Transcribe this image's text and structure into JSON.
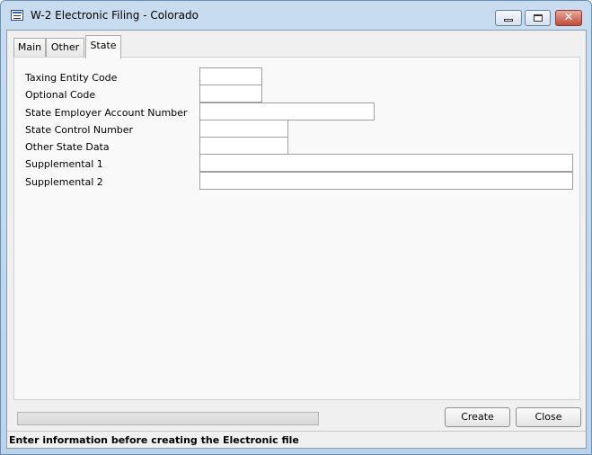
{
  "window": {
    "title": "W-2 Electronic Filing - Colorado"
  },
  "tabs": [
    {
      "label": "Main"
    },
    {
      "label": "Other"
    },
    {
      "label": "State",
      "active": true
    }
  ],
  "form": {
    "taxing_entity_code": {
      "label": "Taxing Entity Code",
      "value": ""
    },
    "optional_code": {
      "label": "Optional Code",
      "value": ""
    },
    "state_employer_account_number": {
      "label": "State Employer Account Number",
      "value": ""
    },
    "state_control_number": {
      "label": "State Control Number",
      "value": ""
    },
    "other_state_data": {
      "label": "Other State Data",
      "value": ""
    },
    "supplemental_1": {
      "label": "Supplemental 1",
      "value": ""
    },
    "supplemental_2": {
      "label": "Supplemental 2",
      "value": ""
    }
  },
  "progress": {
    "value": 0
  },
  "buttons": {
    "create": "Create",
    "close": "Close"
  },
  "status": {
    "text": "Enter information before creating the Electronic file"
  }
}
